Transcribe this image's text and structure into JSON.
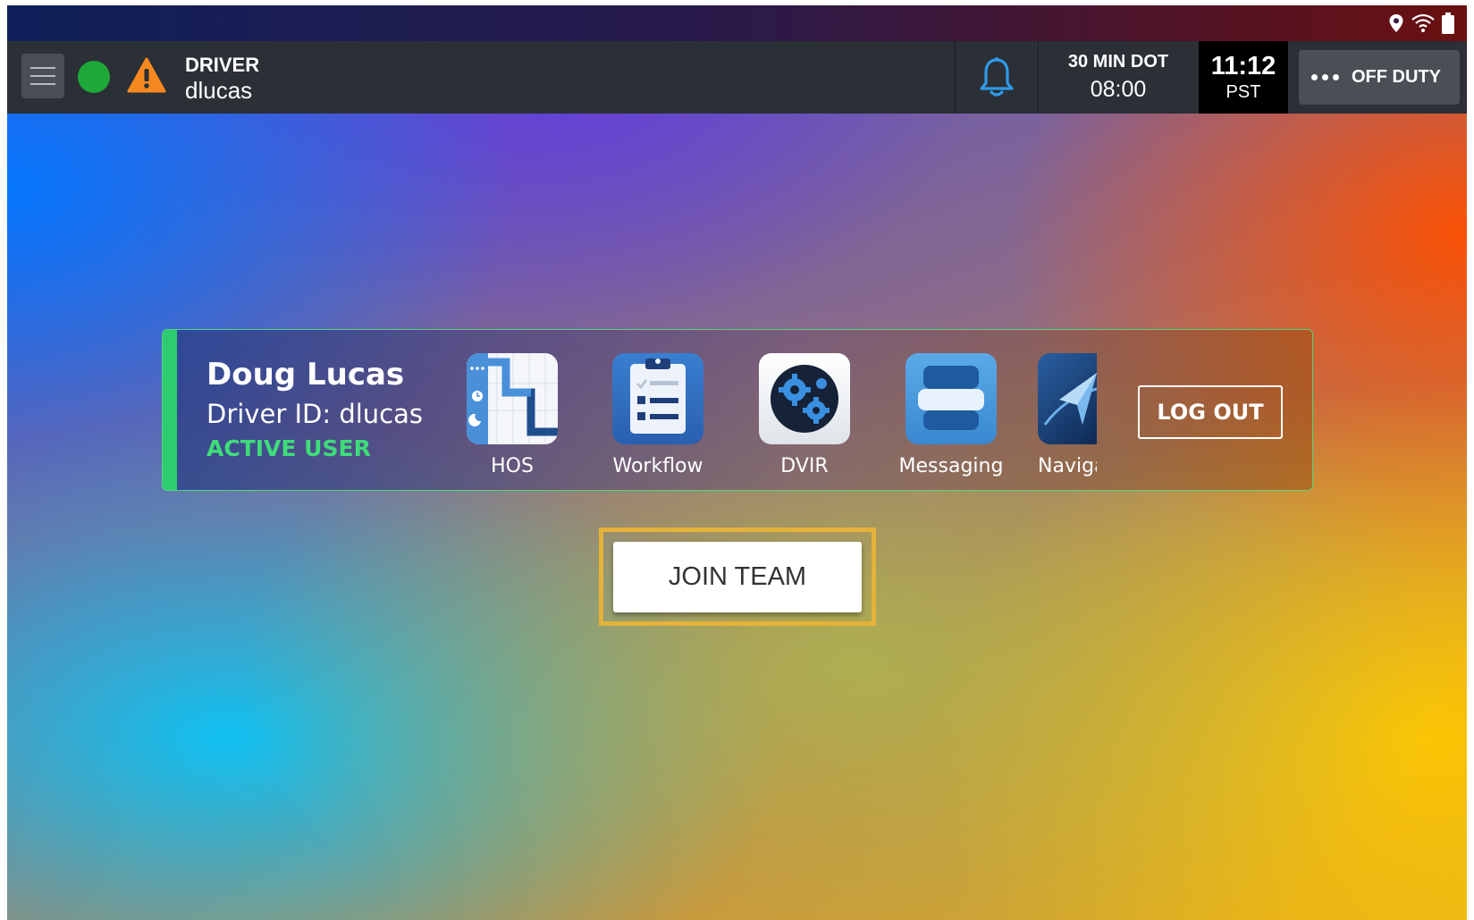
{
  "status_bar": {
    "icons": [
      "location-icon",
      "wifi-icon",
      "battery-icon"
    ]
  },
  "header": {
    "role": "DRIVER",
    "username": "dlucas",
    "status_color": "#1fa83a",
    "warning_color": "#f5891f",
    "dot_label": "30 MIN DOT",
    "dot_value": "08:00",
    "time": "11:12",
    "timezone": "PST",
    "duty_status": "OFF DUTY"
  },
  "user_card": {
    "name": "Doug Lucas",
    "driver_id": "Driver ID: dlucas",
    "status": "ACTIVE USER",
    "accent_color": "#2ecc71",
    "apps": [
      {
        "label": "HOS",
        "icon": "hos-app-icon"
      },
      {
        "label": "Workflow",
        "icon": "workflow-app-icon"
      },
      {
        "label": "DVIR",
        "icon": "dvir-app-icon"
      },
      {
        "label": "Messaging",
        "icon": "messaging-app-icon"
      },
      {
        "label": "Naviga",
        "icon": "navigation-app-icon"
      }
    ],
    "logout_label": "LOG OUT"
  },
  "join_team": {
    "label": "JOIN TEAM",
    "highlight_color": "#e5b23a"
  }
}
